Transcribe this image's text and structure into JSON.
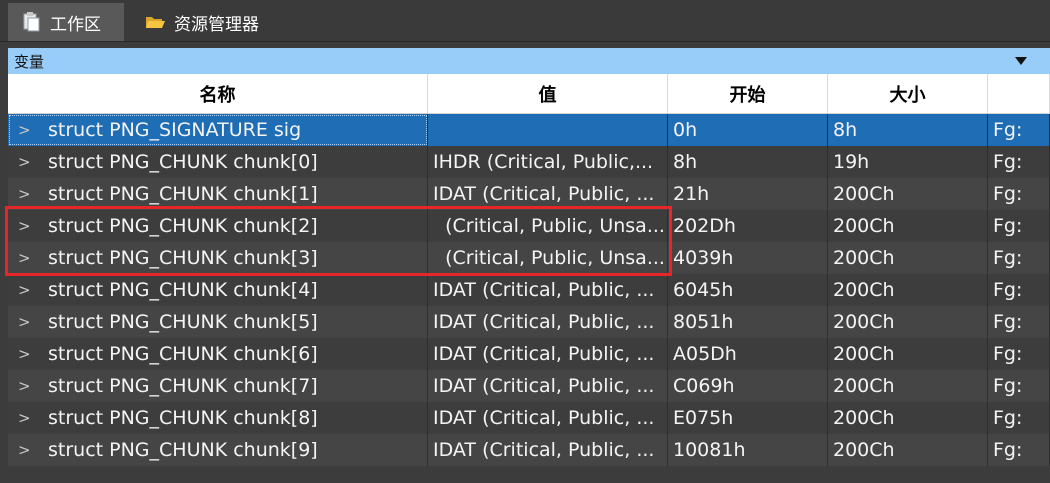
{
  "tabs": [
    {
      "label": "工作区",
      "icon": "clipboard-icon",
      "active": true
    },
    {
      "label": "资源管理器",
      "icon": "folder-icon",
      "active": false
    }
  ],
  "panel": {
    "title": "变量",
    "dropdown_icon": "triangle-down-icon"
  },
  "table": {
    "columns": [
      "名称",
      "值",
      "开始",
      "大小",
      ""
    ],
    "rows": [
      {
        "name": "struct PNG_SIGNATURE sig",
        "value": "",
        "start": "0h",
        "size": "8h",
        "color": "Fg:",
        "selected": true
      },
      {
        "name": "struct PNG_CHUNK chunk[0]",
        "value": "IHDR  (Critical, Public,...",
        "start": "8h",
        "size": "19h",
        "color": "Fg:"
      },
      {
        "name": "struct PNG_CHUNK chunk[1]",
        "value": "IDAT  (Critical, Public, ...",
        "start": "21h",
        "size": "200Ch",
        "color": "Fg:"
      },
      {
        "name": "struct PNG_CHUNK chunk[2]",
        "value": "  (Critical, Public, Unsa...",
        "start": "202Dh",
        "size": "200Ch",
        "color": "Fg:"
      },
      {
        "name": "struct PNG_CHUNK chunk[3]",
        "value": "  (Critical, Public, Unsa...",
        "start": "4039h",
        "size": "200Ch",
        "color": "Fg:"
      },
      {
        "name": "struct PNG_CHUNK chunk[4]",
        "value": "IDAT  (Critical, Public, ...",
        "start": "6045h",
        "size": "200Ch",
        "color": "Fg:"
      },
      {
        "name": "struct PNG_CHUNK chunk[5]",
        "value": "IDAT  (Critical, Public, ...",
        "start": "8051h",
        "size": "200Ch",
        "color": "Fg:"
      },
      {
        "name": "struct PNG_CHUNK chunk[6]",
        "value": "IDAT  (Critical, Public, ...",
        "start": "A05Dh",
        "size": "200Ch",
        "color": "Fg:"
      },
      {
        "name": "struct PNG_CHUNK chunk[7]",
        "value": "IDAT  (Critical, Public, ...",
        "start": "C069h",
        "size": "200Ch",
        "color": "Fg:"
      },
      {
        "name": "struct PNG_CHUNK chunk[8]",
        "value": "IDAT  (Critical, Public, ...",
        "start": "E075h",
        "size": "200Ch",
        "color": "Fg:"
      },
      {
        "name": "struct PNG_CHUNK chunk[9]",
        "value": "IDAT  (Critical, Public, ...",
        "start": "10081h",
        "size": "200Ch",
        "color": "Fg:"
      }
    ]
  },
  "annotation": {
    "color": "#e8262a"
  }
}
